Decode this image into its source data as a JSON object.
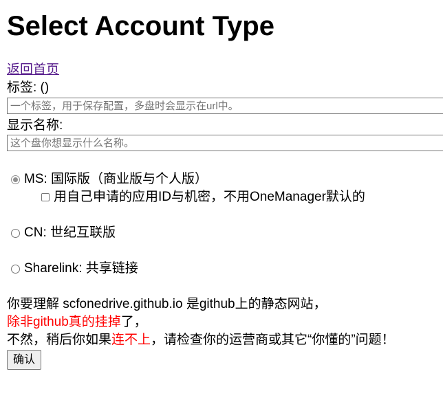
{
  "page": {
    "title": "Select Account Type",
    "home_link": "返回首页"
  },
  "form": {
    "tag_label": "标签: ()",
    "tag_placeholder": "一个标签，用于保存配置，多盘时会显示在url中。",
    "display_name_label": "显示名称:",
    "display_name_placeholder": "这个盘你想显示什么名称。"
  },
  "account_types": [
    {
      "label": "MS: 国际版（商业版与个人版）",
      "selected": true
    },
    {
      "label": "CN: 世纪互联版",
      "selected": false
    },
    {
      "label": "Sharelink: 共享链接",
      "selected": false
    }
  ],
  "own_app_checkbox": {
    "label": "用自己申请的应用ID与机密，不用OneManager默认的",
    "checked": false
  },
  "notice": {
    "line1": "你要理解 scfonedrive.github.io 是github上的静态网站，",
    "line2_red": "除非github真的挂掉",
    "line2_rest": "了，",
    "line3_a": "不然，稍后你如果",
    "line3_red": "连不上",
    "line3_b": "，请检查你的运营商或其它“你懂的”问题！"
  },
  "confirm_label": "确认",
  "colors": {
    "link": "#551a8b",
    "warning": "#ff0000"
  }
}
